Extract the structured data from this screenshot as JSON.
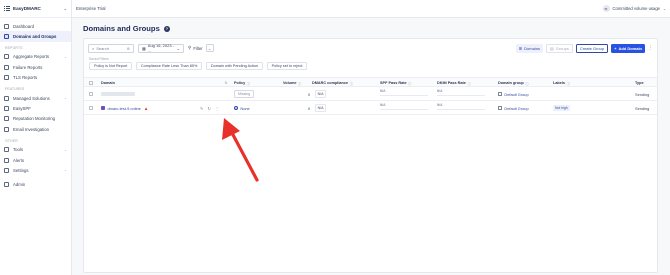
{
  "brand": {
    "name": "EasyDMARC"
  },
  "topbar": {
    "plan": "Enterprise Trial",
    "avatar_initials": "m",
    "usage_label": "Committed volume usage"
  },
  "sidebar": {
    "top_items": [
      {
        "label": "Dashboard"
      },
      {
        "label": "Domains and Groups"
      }
    ],
    "reports_title": "REPORTS",
    "reports": [
      {
        "label": "Aggregate Reports"
      },
      {
        "label": "Failure Reports"
      },
      {
        "label": "TLS Reports"
      }
    ],
    "features_title": "FEATURES",
    "features": [
      {
        "label": "Managed Solutions"
      },
      {
        "label": "EasySPF"
      },
      {
        "label": "Reputation Monitoring"
      },
      {
        "label": "Email Investigation"
      }
    ],
    "other_title": "OTHER",
    "other": [
      {
        "label": "Tools"
      },
      {
        "label": "Alerts"
      },
      {
        "label": "Settings"
      },
      {
        "label": "Admin"
      }
    ]
  },
  "page": {
    "title": "Domains and Groups"
  },
  "toolbar": {
    "search_placeholder": "Search",
    "date_value": "Aug 16, 2023 - ...",
    "filter_label": "Filter",
    "domains_label": "Domains",
    "groups_label": "Groups",
    "create_group_label": "Create Group",
    "add_domain_label": "Add Domain"
  },
  "saved_filters": {
    "title": "Saved Filters",
    "chips": [
      "Policy is Not Report",
      "Compliance Rate Less Than 85%",
      "Domain with Pending Action",
      "Policy set to reject"
    ]
  },
  "table": {
    "columns": {
      "domain": "Domain",
      "policy": "Policy",
      "volume": "Volume",
      "dmarc": "DMARC compliance",
      "spf": "SPF Pass Rate",
      "dkim": "DKIM Pass Rate",
      "group": "Domain group",
      "labels": "Labels",
      "type": "Type"
    },
    "rows": [
      {
        "domain": "",
        "policy": "Missing",
        "volume": "0",
        "dmarc": "N/A",
        "spf": "N/A",
        "dkim": "N/A",
        "group": "Default Group",
        "label": "",
        "type": "Sending"
      },
      {
        "domain": "dmarc-test-9.online",
        "policy": "None",
        "volume": "0",
        "dmarc": "N/A",
        "spf": "N/A",
        "dkim": "N/A",
        "group": "Default Group",
        "label": "Not high",
        "type": "Sending"
      }
    ]
  },
  "colors": {
    "accent": "#2952e3",
    "annotation_arrow": "#e8312a"
  }
}
